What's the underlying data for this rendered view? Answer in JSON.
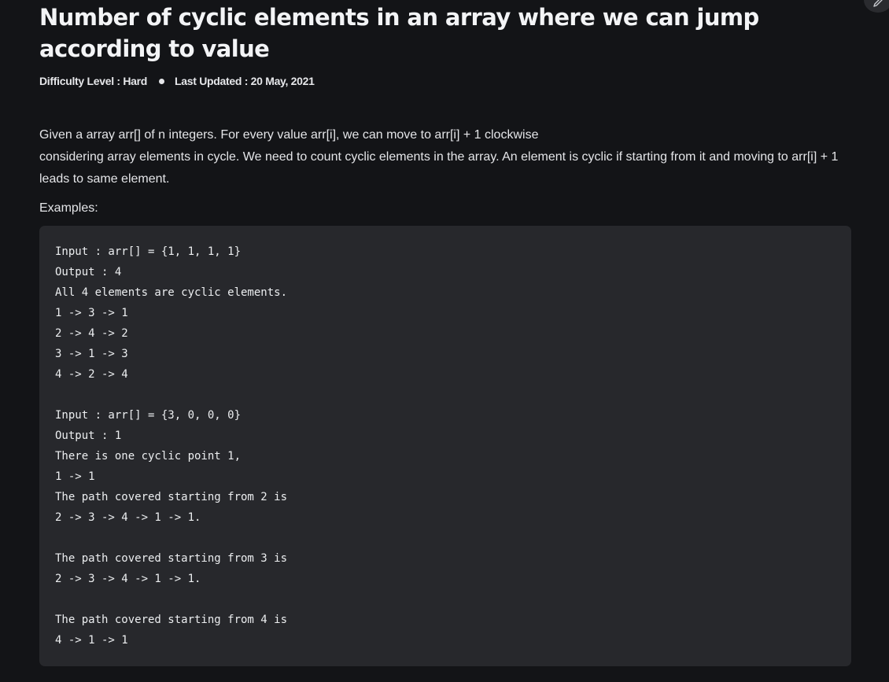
{
  "article": {
    "title": "Number of cyclic elements in an array where we can jump according to value",
    "difficulty": "Difficulty Level : Hard",
    "last_updated": "Last Updated : 20 May, 2021",
    "description_line1": "Given a array arr[] of n integers. For every value arr[i], we can move to arr[i] + 1 clockwise",
    "description_line2": "considering array elements in cycle. We need to count cyclic elements in the array. An element is cyclic if starting from it and moving to arr[i] + 1 leads to same element.",
    "examples_label": "Examples:",
    "code_lines": [
      "Input : arr[] = {1, 1, 1, 1}",
      "Output : 4",
      "All 4 elements are cyclic elements.",
      "1 -> 3 -> 1",
      "2 -> 4 -> 2",
      "3 -> 1 -> 3",
      "4 -> 2 -> 4",
      "",
      "Input : arr[] = {3, 0, 0, 0}",
      "Output : 1",
      "There is one cyclic point 1,",
      "1 -> 1",
      "The path covered starting from 2 is",
      "2 -> 3 -> 4 -> 1 -> 1.",
      "",
      "The path covered starting from 3 is",
      "2 -> 3 -> 4 -> 1 -> 1.",
      "",
      "The path covered starting from 4 is",
      "4 -> 1 -> 1"
    ]
  },
  "icons": {
    "edit": "pencil-icon"
  },
  "colors": {
    "background": "#131417",
    "code_background": "#27282c",
    "text": "#e9eaec"
  }
}
